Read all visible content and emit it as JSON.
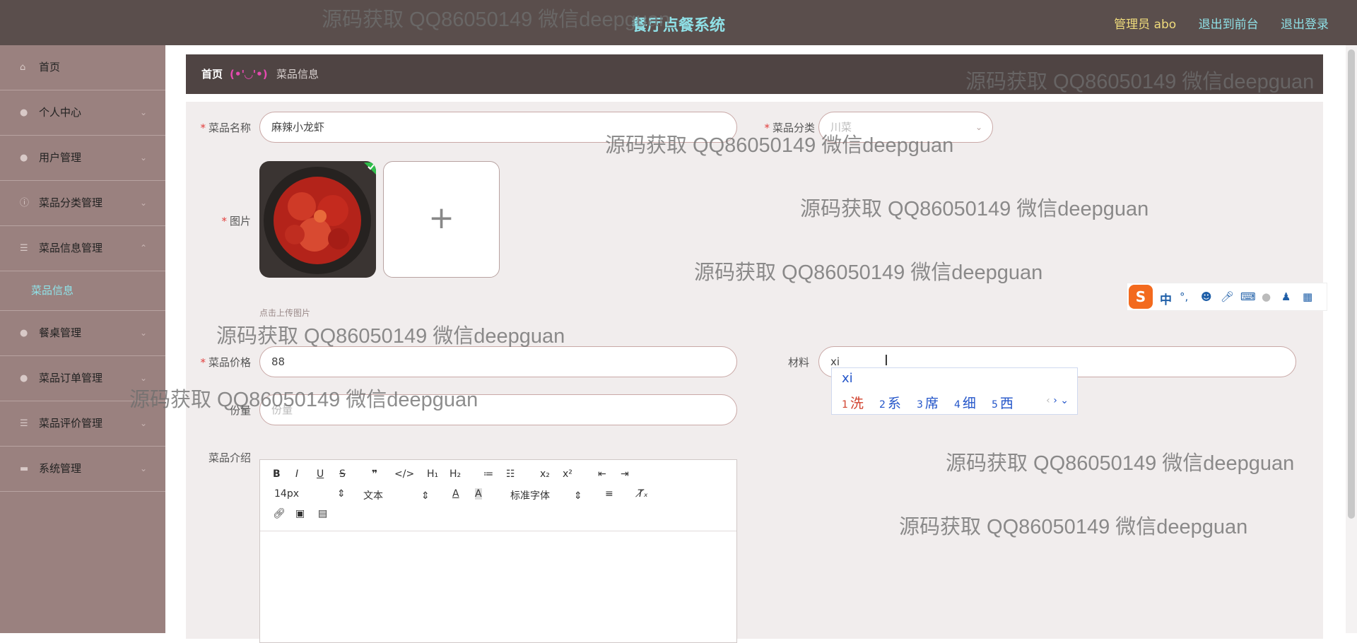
{
  "header": {
    "app_title": "餐厅点餐系统",
    "admin_label": "管理员 abo",
    "front_link": "退出到前台",
    "logout_link": "退出登录"
  },
  "sidebar": {
    "items": [
      {
        "label": "首页",
        "icon": "home-icon"
      },
      {
        "label": "个人中心",
        "icon": "user-icon"
      },
      {
        "label": "用户管理",
        "icon": "user-icon"
      },
      {
        "label": "菜品分类管理",
        "icon": "info-icon"
      },
      {
        "label": "菜品信息管理",
        "icon": "list-icon"
      },
      {
        "label": "餐桌管理",
        "icon": "user-icon"
      },
      {
        "label": "菜品订单管理",
        "icon": "user-icon"
      },
      {
        "label": "菜品评价管理",
        "icon": "list-icon"
      },
      {
        "label": "系统管理",
        "icon": "settings-icon"
      }
    ],
    "active_sub": "菜品信息"
  },
  "breadcrumb": {
    "home": "首页",
    "separator": "(•'◡'•)",
    "current": "菜品信息"
  },
  "form": {
    "name_label": "菜品名称",
    "name_value": "麻辣小龙虾",
    "category_label": "菜品分类",
    "category_value": "川菜",
    "image_label": "图片",
    "upload_plus": "+",
    "upload_tip": "点击上传图片",
    "price_label": "菜品价格",
    "price_value": "88",
    "material_label": "材料",
    "material_value": "xi",
    "portion_label": "份量",
    "portion_placeholder": "份量",
    "intro_label": "菜品介绍"
  },
  "editor": {
    "font_size": "14px",
    "paragraph": "文本",
    "font_family": "标准字体"
  },
  "ime": {
    "mode": "中",
    "composition": "xi",
    "candidates": [
      {
        "num": "1",
        "text": "洗"
      },
      {
        "num": "2",
        "text": "系"
      },
      {
        "num": "3",
        "text": "席"
      },
      {
        "num": "4",
        "text": "细"
      },
      {
        "num": "5",
        "text": "西"
      }
    ]
  },
  "watermark": "源码获取 QQ86050149 微信deepguan"
}
